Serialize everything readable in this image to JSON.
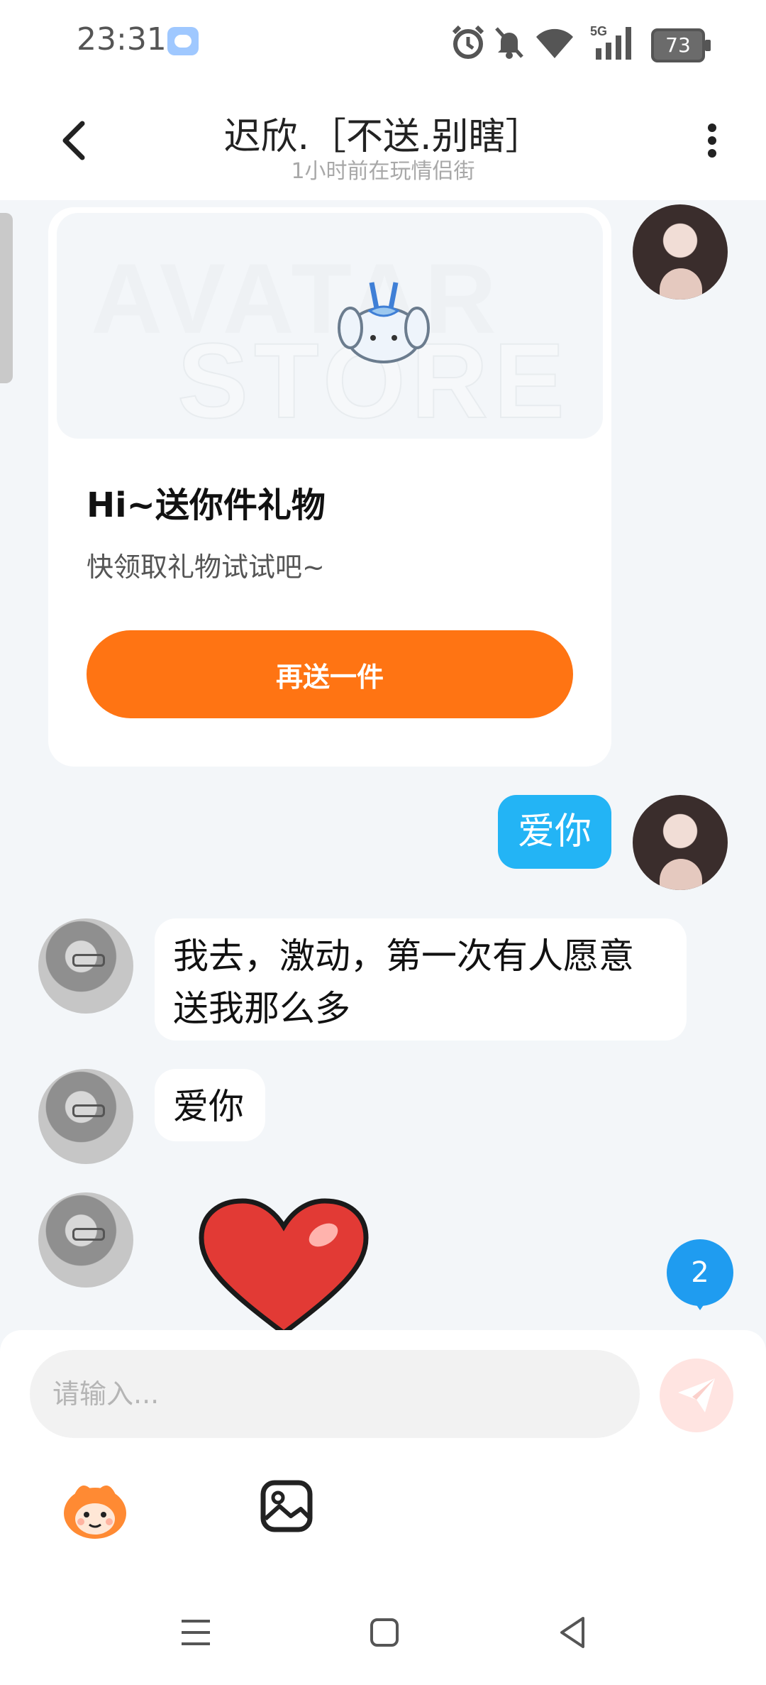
{
  "status_bar": {
    "time": "23:31",
    "battery": "73",
    "icons": [
      "weather-icon",
      "alarm-icon",
      "mute-icon",
      "wifi-icon",
      "signal-5g-icon",
      "battery-icon"
    ]
  },
  "header": {
    "title": "迟欣.［不送.别瞎］",
    "subtitle": "1小时前在玩情侣街"
  },
  "gift_card": {
    "watermark_top": "AVATAR",
    "watermark_bottom": "STORE",
    "title": "Hi~送你件礼物",
    "description": "快领取礼物试试吧~",
    "button_label": "再送一件"
  },
  "messages": [
    {
      "from": "me",
      "text": "爱你"
    },
    {
      "from": "other",
      "text": "我去，激动，第一次有人愿意送我那么多"
    },
    {
      "from": "other",
      "text": "爱你"
    },
    {
      "from": "other",
      "sticker": "heart-sticker"
    }
  ],
  "unread_badge": "2",
  "composer": {
    "placeholder": "请输入..."
  },
  "colors": {
    "accent_orange": "#ff7413",
    "my_bubble": "#23b4f5",
    "badge_blue": "#1f9cf0",
    "send_button_disabled": "#ffe4e1"
  }
}
